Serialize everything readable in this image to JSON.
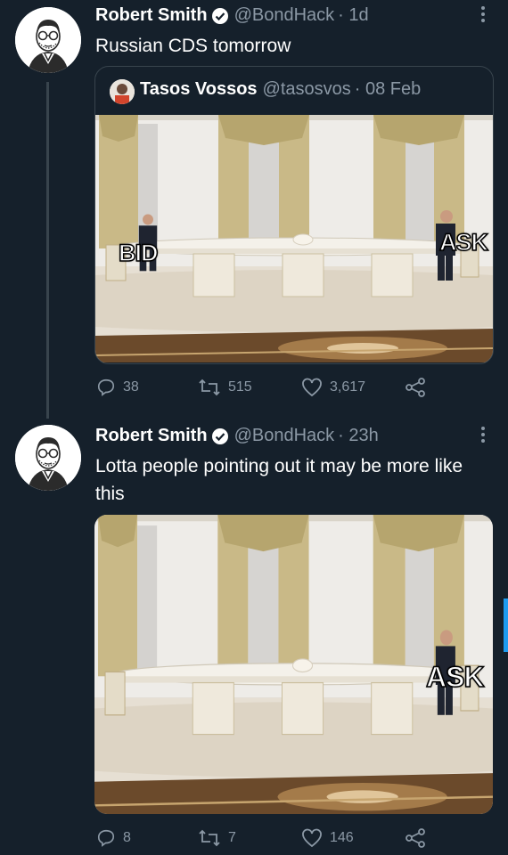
{
  "tweets": [
    {
      "author_name": "Robert Smith",
      "handle": "@BondHack",
      "time": "· 1d",
      "text": "Russian CDS tomorrow",
      "quote": {
        "author_name": "Tasos Vossos",
        "handle": "@tasosvos",
        "time": "· 08 Feb",
        "labels": {
          "left": "BID",
          "right": "ASK"
        }
      },
      "stats": {
        "replies": "38",
        "retweets": "515",
        "likes": "3,617"
      }
    },
    {
      "author_name": "Robert Smith",
      "handle": "@BondHack",
      "time": "· 23h",
      "text": "Lotta people pointing out it may be more like this",
      "labels": {
        "right": "ASK"
      },
      "stats": {
        "replies": "8",
        "retweets": "7",
        "likes": "146"
      }
    }
  ],
  "icons": {
    "verified": "verified-badge-icon",
    "reply": "reply-icon",
    "retweet": "retweet-icon",
    "like": "heart-icon",
    "share": "share-icon",
    "more": "more-icon"
  },
  "colors": {
    "background": "#15202b",
    "muted": "#8b98a5",
    "accent": "#1d9bf0"
  }
}
